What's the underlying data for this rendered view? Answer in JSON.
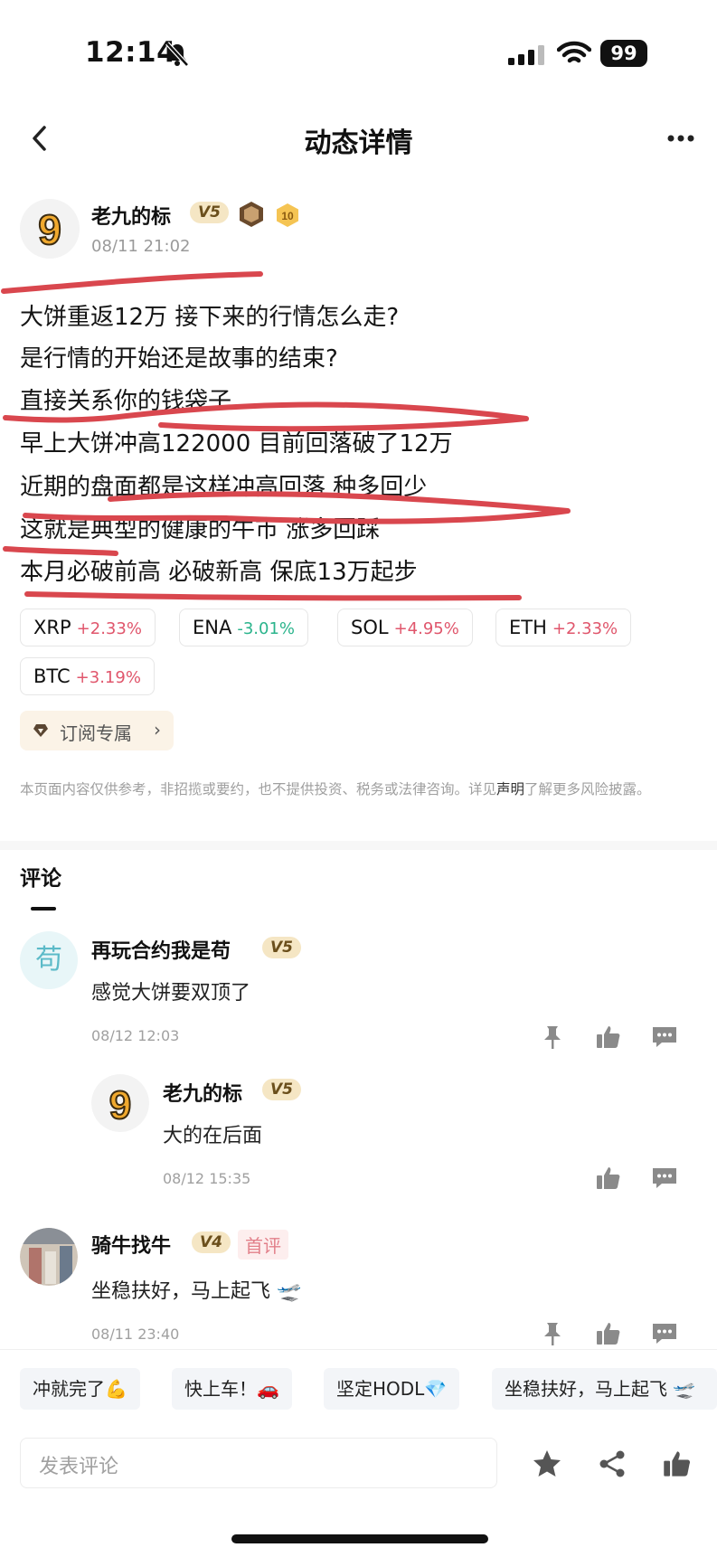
{
  "status_bar": {
    "time": "12:14",
    "battery": "99"
  },
  "header": {
    "title": "动态详情"
  },
  "post": {
    "author": "老九的标",
    "level": "V5",
    "medal_level": "10",
    "timestamp": "08/11 21:02",
    "lines": [
      "大饼重返12万 接下来的行情怎么走?",
      "是行情的开始还是故事的结束?",
      "直接关系你的钱袋子",
      "早上大饼冲高122000 目前回落破了12万",
      "近期的盘面都是这样冲高回落 种多回少",
      "这就是典型的健康的牛市 涨多回踩",
      "本月必破前高 必破新高 保底13万起步"
    ],
    "tickers": [
      {
        "symbol": "XRP",
        "change": "+2.33%",
        "direction": "up"
      },
      {
        "symbol": "ENA",
        "change": "-3.01%",
        "direction": "down"
      },
      {
        "symbol": "SOL",
        "change": "+4.95%",
        "direction": "up"
      },
      {
        "symbol": "ETH",
        "change": "+2.33%",
        "direction": "up"
      },
      {
        "symbol": "BTC",
        "change": "+3.19%",
        "direction": "up"
      }
    ],
    "subscribe_label": "订阅专属",
    "disclaimer_before": "本页面内容仅供参考，非招揽或要约，也不提供投资、税务或法律咨询。详见",
    "disclaimer_link": "声明",
    "disclaimer_after": "了解更多风险披露。"
  },
  "comments": {
    "title": "评论",
    "items": [
      {
        "avatar_char": "苟",
        "name": "再玩合约我是苟",
        "level": "V5",
        "text": "感觉大饼要双顶了",
        "time": "08/12 12:03"
      },
      {
        "name": "老九的标",
        "level": "V5",
        "text": "大的在后面",
        "time": "08/12 15:35"
      },
      {
        "name": "骑牛找牛",
        "level": "V4",
        "tag": "首评",
        "text": "坐稳扶好，马上起飞 🛫",
        "time": "08/11 23:40"
      }
    ]
  },
  "quick_replies": [
    "冲就完了💪",
    "快上车！🚗",
    "坚定HODL💎",
    "坐稳扶好，马上起飞 🛫"
  ],
  "input": {
    "placeholder": "发表评论"
  },
  "colors": {
    "up": "#e0566c",
    "down": "#2bb48c",
    "scribble": "#d9474e",
    "badge": "#f5e6c4"
  }
}
